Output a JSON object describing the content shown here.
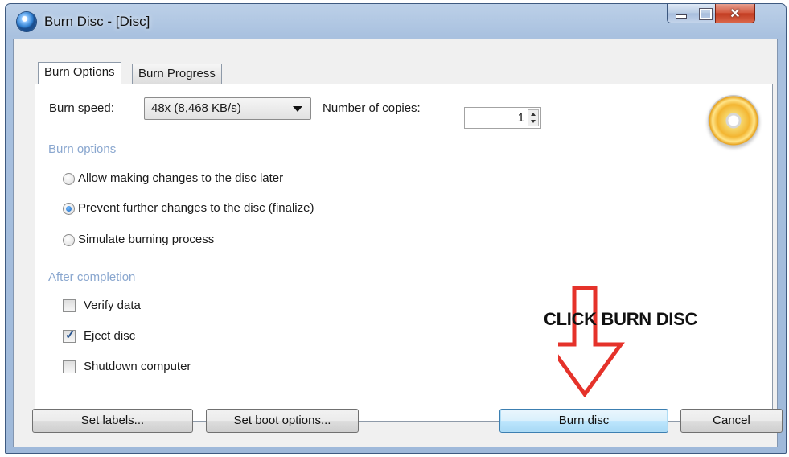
{
  "window": {
    "title": "Burn Disc - [Disc]"
  },
  "tabs": [
    {
      "label": "Burn Options",
      "active": true
    },
    {
      "label": "Burn Progress",
      "active": false
    }
  ],
  "burn_speed": {
    "label": "Burn speed:",
    "value": "48x (8,468 KB/s)"
  },
  "copies": {
    "label": "Number of copies:",
    "value": "1"
  },
  "burn_options": {
    "group_label": "Burn options",
    "items": [
      {
        "label": "Allow making changes to the disc later",
        "selected": false
      },
      {
        "label": "Prevent further changes to the disc (finalize)",
        "selected": true
      },
      {
        "label": "Simulate burning process",
        "selected": false
      }
    ]
  },
  "after_completion": {
    "group_label": "After completion",
    "items": [
      {
        "label": "Verify data",
        "checked": false
      },
      {
        "label": "Eject disc",
        "checked": true
      },
      {
        "label": "Shutdown computer",
        "checked": false
      }
    ]
  },
  "buttons": {
    "set_labels": "Set labels...",
    "set_boot_options": "Set boot options...",
    "burn_disc": "Burn disc",
    "cancel": "Cancel"
  },
  "annotation": {
    "text": "CLICK BURN DISC",
    "arrow_color": "#e5322a"
  },
  "icons": {
    "app": "disc-burn-app-icon",
    "disc": "golden-disc-icon"
  }
}
